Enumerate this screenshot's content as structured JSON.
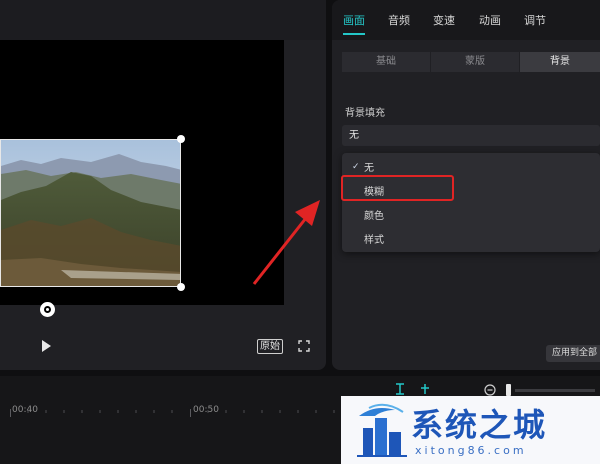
{
  "panel": {
    "tabs": [
      {
        "label": "画面"
      },
      {
        "label": "音频"
      },
      {
        "label": "变速"
      },
      {
        "label": "动画"
      },
      {
        "label": "调节"
      }
    ],
    "active_tab": "画面",
    "segments": [
      {
        "label": "基础"
      },
      {
        "label": "蒙版"
      },
      {
        "label": "背景"
      }
    ],
    "active_segment": "背景",
    "background_fill": {
      "label": "背景填充",
      "selected": "无",
      "options": [
        {
          "label": "无"
        },
        {
          "label": "模糊"
        },
        {
          "label": "颜色"
        },
        {
          "label": "样式"
        }
      ],
      "highlighted_option": "模糊"
    },
    "apply_all_label": "应用到全部"
  },
  "player": {
    "ratio_label": "原始"
  },
  "timeline": {
    "labels": [
      {
        "text": "00:40"
      },
      {
        "text": "00:50"
      }
    ]
  },
  "watermark": {
    "title": "系统之城",
    "url": "xitong86.com"
  },
  "colors": {
    "accent": "#24c7c8",
    "highlight": "#e02424",
    "watermark_blue": "#1e56b8"
  }
}
